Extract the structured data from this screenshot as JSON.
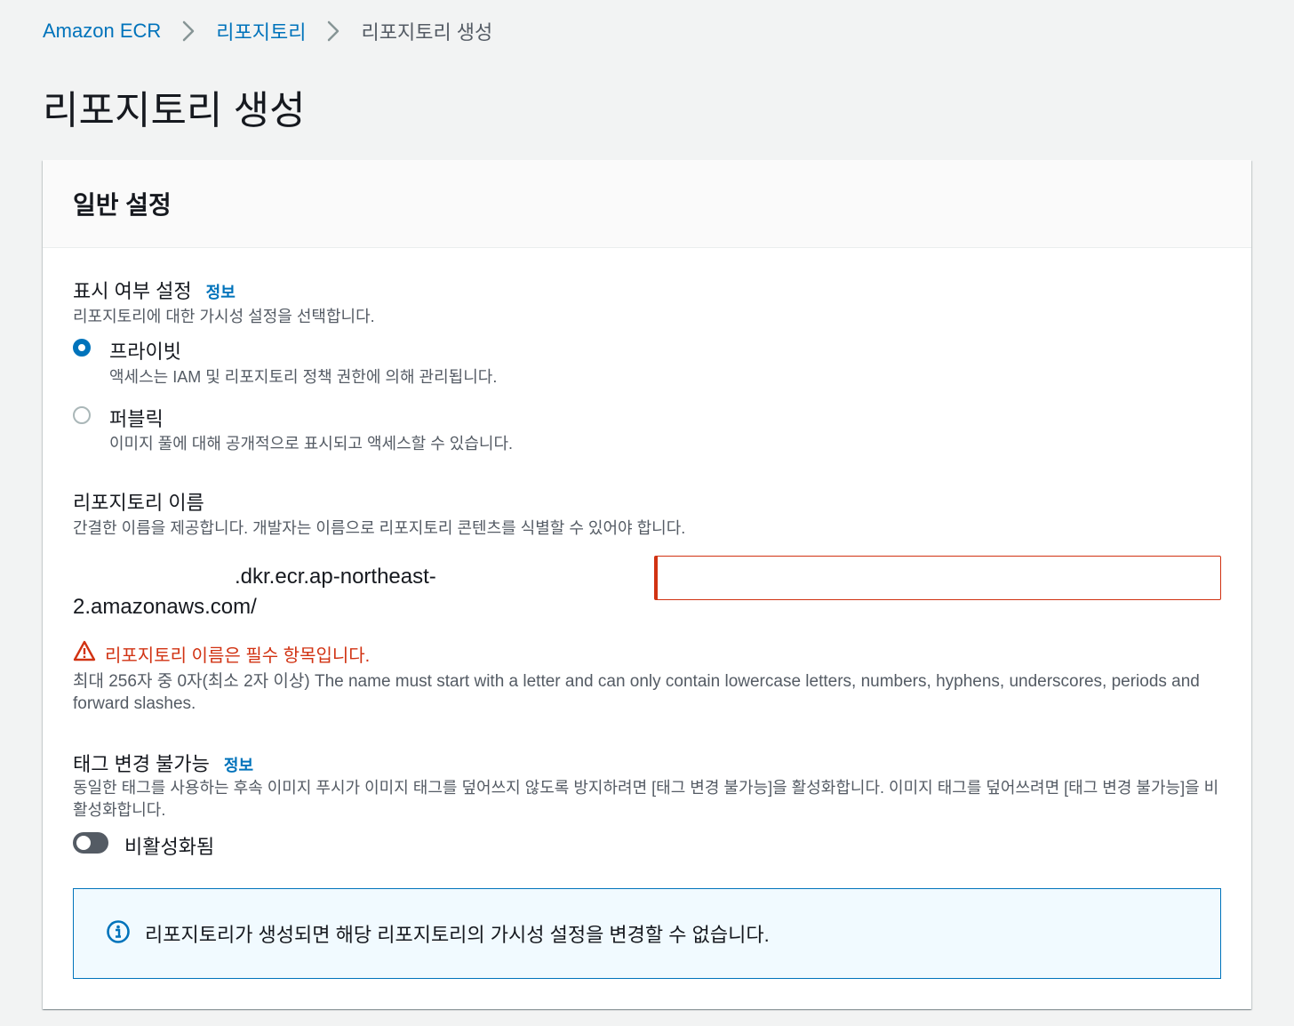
{
  "breadcrumb": {
    "items": [
      "Amazon ECR",
      "리포지토리",
      "리포지토리 생성"
    ]
  },
  "page": {
    "title": "리포지토리 생성"
  },
  "general_settings": {
    "title": "일반 설정",
    "visibility": {
      "label": "표시 여부 설정",
      "info": "정보",
      "description": "리포지토리에 대한 가시성 설정을 선택합니다.",
      "options": [
        {
          "label": "프라이빗",
          "description": "액세스는 IAM 및 리포지토리 정책 권한에 의해 관리됩니다.",
          "selected": true
        },
        {
          "label": "퍼블릭",
          "description": "이미지 풀에 대해 공개적으로 표시되고 액세스할 수 있습니다.",
          "selected": false
        }
      ]
    },
    "repository_name": {
      "label": "리포지토리 이름",
      "description": "간결한 이름을 제공합니다. 개발자는 이름으로 리포지토리 콘텐츠를 식별할 수 있어야 합니다.",
      "uri_prefix_line1": ".dkr.ecr.ap-northeast-",
      "uri_prefix_line2": "2.amazonaws.com/",
      "value": "",
      "error": "리포지토리 이름은 필수 항목입니다.",
      "constraint": "최대 256자 중 0자(최소 2자 이상) The name must start with a letter and can only contain lowercase letters, numbers, hyphens, underscores, periods and forward slashes."
    },
    "tag_immutability": {
      "label": "태그 변경 불가능",
      "info": "정보",
      "description": "동일한 태그를 사용하는 후속 이미지 푸시가 이미지 태그를 덮어쓰지 않도록 방지하려면 [태그 변경 불가능]을 활성화합니다. 이미지 태그를 덮어쓰려면 [태그 변경 불가능]을 비활성화합니다.",
      "toggle_label": "비활성화됨",
      "enabled": false
    },
    "alert": {
      "text": "리포지토리가 생성되면 해당 리포지토리의 가시성 설정을 변경할 수 없습니다."
    }
  },
  "colors": {
    "link": "#0073bb",
    "error": "#d13212",
    "text": "#16191f",
    "secondary_text": "#545b64",
    "background": "#f2f3f3",
    "alert_background": "#f1faff"
  },
  "icons": [
    "chevron-right-icon",
    "warning-icon",
    "info-icon"
  ]
}
